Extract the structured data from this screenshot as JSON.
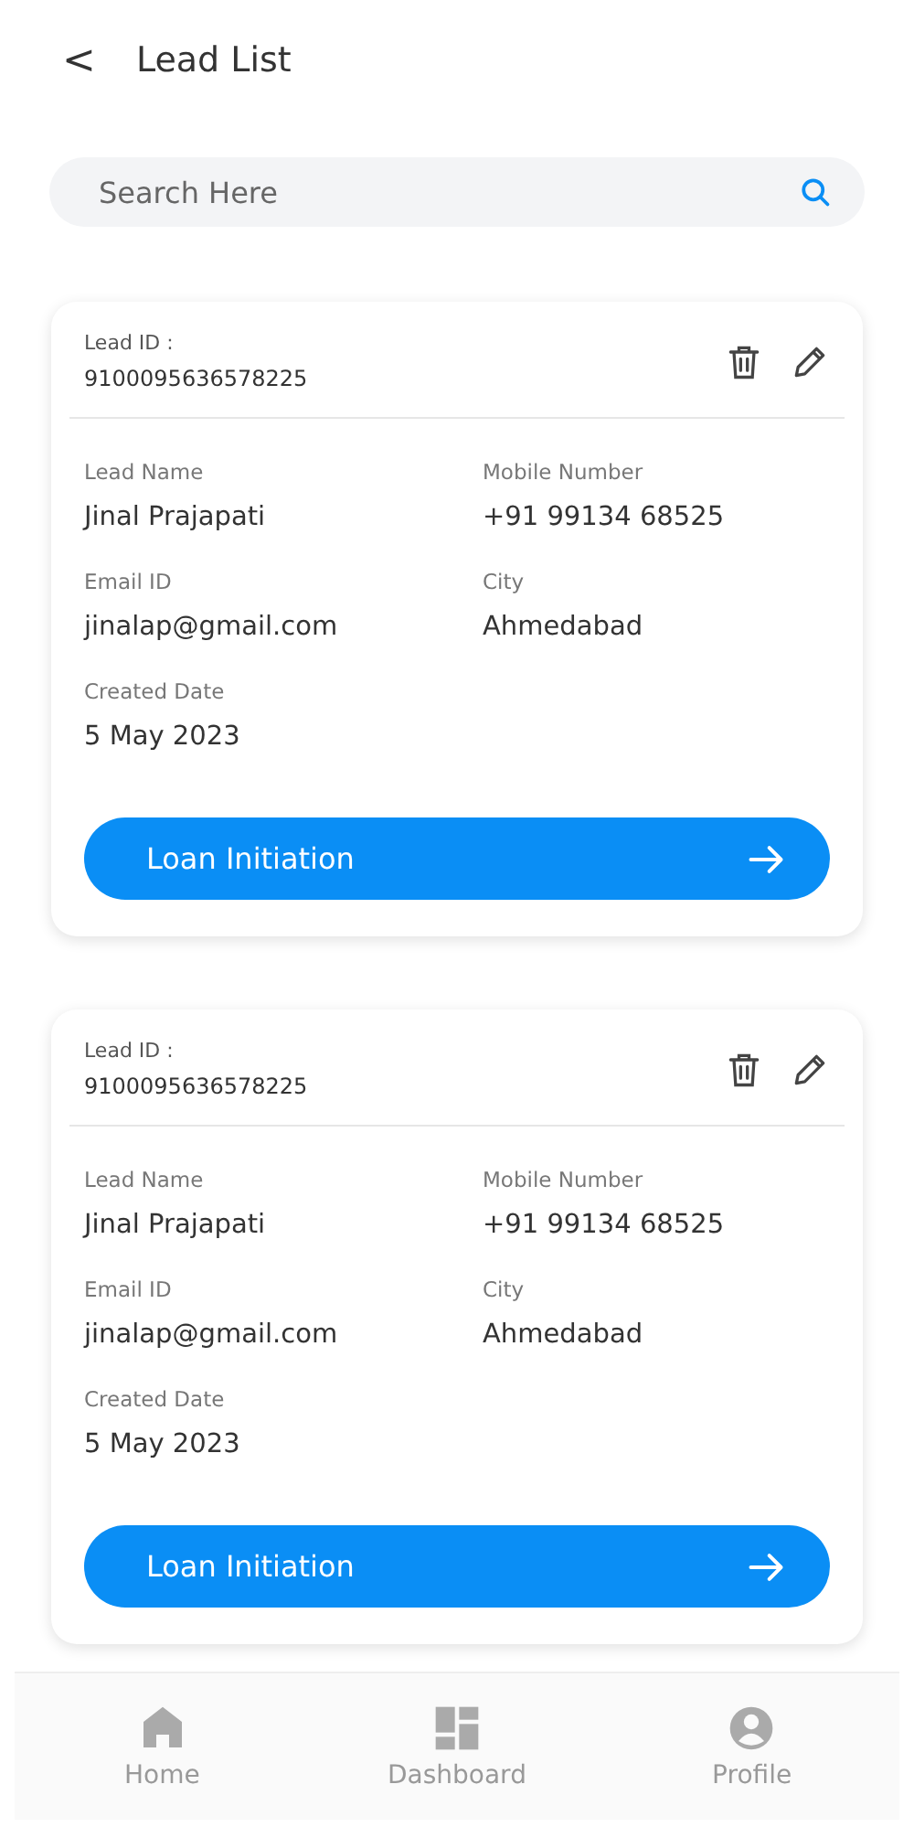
{
  "header": {
    "back": "<",
    "title": "Lead List"
  },
  "search": {
    "placeholder": "Search Here"
  },
  "leads": [
    {
      "id_label": "Lead ID :",
      "id": "9100095636578225",
      "fields": [
        {
          "label": "Lead Name",
          "value": "Jinal Prajapati"
        },
        {
          "label": "Mobile Number",
          "value": "+91 99134 68525"
        },
        {
          "label": "Email ID",
          "value": "jinalap@gmail.com"
        },
        {
          "label": "City",
          "value": "Ahmedabad"
        },
        {
          "label": "Created Date",
          "value": "5 May 2023"
        }
      ],
      "action": "Loan Initiation"
    },
    {
      "id_label": "Lead ID :",
      "id": "9100095636578225",
      "fields": [
        {
          "label": "Lead Name",
          "value": "Jinal Prajapati"
        },
        {
          "label": "Mobile Number",
          "value": "+91 99134 68525"
        },
        {
          "label": "Email ID",
          "value": "jinalap@gmail.com"
        },
        {
          "label": "City",
          "value": "Ahmedabad"
        },
        {
          "label": "Created Date",
          "value": "5 May 2023"
        }
      ],
      "action": "Loan Initiation"
    }
  ],
  "nav": [
    {
      "kind": "home",
      "label": "Home",
      "selected": false
    },
    {
      "kind": "dashboard",
      "label": "Dashboard",
      "selected": false
    },
    {
      "kind": "profile",
      "label": "Profile",
      "selected": false
    }
  ]
}
